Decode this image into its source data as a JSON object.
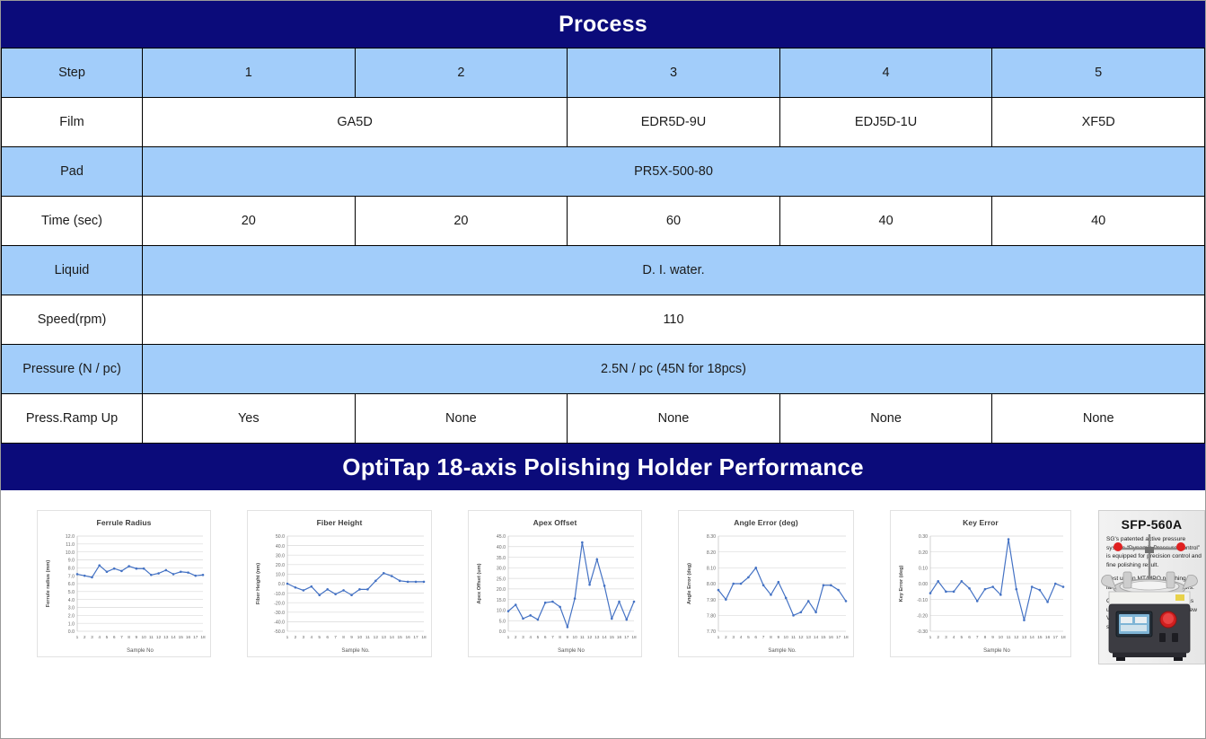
{
  "process": {
    "banner_title": "Process",
    "rows": [
      {
        "label": "Step",
        "style": "blue",
        "cells": [
          {
            "text": "1",
            "span": 1
          },
          {
            "text": "2",
            "span": 1
          },
          {
            "text": "3",
            "span": 1
          },
          {
            "text": "4",
            "span": 1
          },
          {
            "text": "5",
            "span": 1
          }
        ]
      },
      {
        "label": "Film",
        "style": "white",
        "cells": [
          {
            "text": "GA5D",
            "span": 2
          },
          {
            "text": "EDR5D-9U",
            "span": 1
          },
          {
            "text": "EDJ5D-1U",
            "span": 1
          },
          {
            "text": "XF5D",
            "span": 1
          }
        ]
      },
      {
        "label": "Pad",
        "style": "blue",
        "cells": [
          {
            "text": "PR5X-500-80",
            "span": 5
          }
        ]
      },
      {
        "label": "Time (sec)",
        "style": "white",
        "cells": [
          {
            "text": "20",
            "span": 1
          },
          {
            "text": "20",
            "span": 1
          },
          {
            "text": "60",
            "span": 1
          },
          {
            "text": "40",
            "span": 1
          },
          {
            "text": "40",
            "span": 1
          }
        ]
      },
      {
        "label": "Liquid",
        "style": "blue",
        "cells": [
          {
            "text": "D. I. water.",
            "span": 5
          }
        ]
      },
      {
        "label": "Speed(rpm)",
        "style": "white",
        "cells": [
          {
            "text": "110",
            "span": 5
          }
        ]
      },
      {
        "label": "Pressure (N / pc)",
        "style": "blue",
        "cells": [
          {
            "text": "2.5N / pc (45N for 18pcs)",
            "span": 5
          }
        ]
      },
      {
        "label": "Press.Ramp Up",
        "style": "white",
        "cells": [
          {
            "text": "Yes",
            "span": 1
          },
          {
            "text": "None",
            "span": 1
          },
          {
            "text": "None",
            "span": 1
          },
          {
            "text": "None",
            "span": 1
          },
          {
            "text": "None",
            "span": 1
          }
        ]
      }
    ]
  },
  "performance": {
    "banner_title": "OptiTap 18-axis Polishing Holder Performance"
  },
  "chart_data": [
    {
      "type": "line",
      "title": "Ferrule Radius",
      "xlabel": "Sample No",
      "ylabel": "Ferrule radius (mm)",
      "x": [
        1,
        2,
        3,
        4,
        5,
        6,
        7,
        8,
        9,
        10,
        11,
        12,
        13,
        14,
        15,
        16,
        17,
        18
      ],
      "ylim": [
        0.0,
        12.0
      ],
      "yticks": [
        "0.0",
        "1.0",
        "2.0",
        "3.0",
        "4.0",
        "5.0",
        "6.0",
        "7.0",
        "8.0",
        "9.0",
        "10.0",
        "11.0",
        "12.0"
      ],
      "grid": true,
      "legend": "none",
      "values": [
        7.2,
        7.0,
        6.8,
        8.3,
        7.5,
        7.9,
        7.6,
        8.2,
        7.9,
        7.9,
        7.1,
        7.3,
        7.7,
        7.2,
        7.5,
        7.4,
        7.0,
        7.1
      ]
    },
    {
      "type": "line",
      "title": "Fiber Height",
      "xlabel": "Sample No.",
      "ylabel": "Fiber Height (nm)",
      "x": [
        1,
        2,
        3,
        4,
        5,
        6,
        7,
        8,
        9,
        10,
        11,
        12,
        13,
        14,
        15,
        16,
        17,
        18
      ],
      "ylim": [
        -50.0,
        50.0
      ],
      "yticks": [
        "-50.0",
        "-40.0",
        "-30.0",
        "-20.0",
        "-10.0",
        "0.0",
        "10.0",
        "20.0",
        "30.0",
        "40.0",
        "50.0"
      ],
      "grid": true,
      "legend": "none",
      "values": [
        0.0,
        -4.0,
        -7.0,
        -3.0,
        -12.0,
        -6.0,
        -11.0,
        -7.0,
        -12.0,
        -6.0,
        -6.0,
        3.0,
        11.0,
        8.0,
        3.0,
        2.0,
        2.0,
        2.0
      ]
    },
    {
      "type": "line",
      "title": "Apex Offset",
      "xlabel": "Sample No",
      "ylabel": "Apex Offset (um)",
      "x": [
        1,
        2,
        3,
        4,
        5,
        6,
        7,
        8,
        9,
        10,
        11,
        12,
        13,
        14,
        15,
        16,
        17,
        18
      ],
      "ylim": [
        0.0,
        45.0
      ],
      "yticks": [
        "0.0",
        "5.0",
        "10.0",
        "15.0",
        "20.0",
        "25.0",
        "30.0",
        "35.0",
        "40.0",
        "45.0"
      ],
      "grid": true,
      "legend": "none",
      "values": [
        9.5,
        12.5,
        6.0,
        7.5,
        5.5,
        13.5,
        14.0,
        11.5,
        2.0,
        15.5,
        42.0,
        22.0,
        34.0,
        21.5,
        6.0,
        14.0,
        5.5,
        14.0
      ]
    },
    {
      "type": "line",
      "title": "Angle Error (deg)",
      "xlabel": "Sample No.",
      "ylabel": "Angle Error (deg)",
      "x": [
        1,
        2,
        3,
        4,
        5,
        6,
        7,
        8,
        9,
        10,
        11,
        12,
        13,
        14,
        15,
        16,
        17,
        18
      ],
      "ylim": [
        7.7,
        8.3
      ],
      "yticks": [
        "7.70",
        "7.80",
        "7.90",
        "8.00",
        "8.10",
        "8.20",
        "8.30"
      ],
      "grid": true,
      "legend": "none",
      "values": [
        7.96,
        7.9,
        8.0,
        8.0,
        8.04,
        8.1,
        7.99,
        7.93,
        8.01,
        7.91,
        7.8,
        7.82,
        7.89,
        7.82,
        7.99,
        7.99,
        7.96,
        7.89
      ]
    },
    {
      "type": "line",
      "title": "Key Error",
      "xlabel": "Sample No",
      "ylabel": "Key Error (deg)",
      "x": [
        1,
        2,
        3,
        4,
        5,
        6,
        7,
        8,
        9,
        10,
        11,
        12,
        13,
        14,
        15,
        16,
        17,
        18
      ],
      "ylim": [
        -0.3,
        0.3
      ],
      "yticks": [
        "-0.30",
        "-0.20",
        "-0.10",
        "0.00",
        "0.10",
        "0.20",
        "0.30"
      ],
      "grid": true,
      "legend": "none",
      "values": [
        -0.06,
        0.015,
        -0.05,
        -0.05,
        0.015,
        -0.03,
        -0.11,
        -0.035,
        -0.02,
        -0.07,
        0.28,
        -0.035,
        -0.23,
        -0.02,
        -0.04,
        -0.115,
        0.0,
        -0.02
      ]
    }
  ],
  "product": {
    "title": "SFP-560A",
    "paragraphs": [
      "SG's patented active pressure system “Dynamic Pressure Control” is equipped for precision control and fine polishing result.",
      "Best use in MT/MPO polishing, larger diameter cable connectors.",
      "Conventional connectors such as uniboot LC with high capacity, new VSFF connectors MDC, SN solutions are also available."
    ]
  },
  "colors": {
    "banner_blue": "#0b0b7a",
    "row_blue": "#a2cdfa",
    "series_blue": "#4472c4",
    "grid_gray": "#d9d9d9"
  }
}
